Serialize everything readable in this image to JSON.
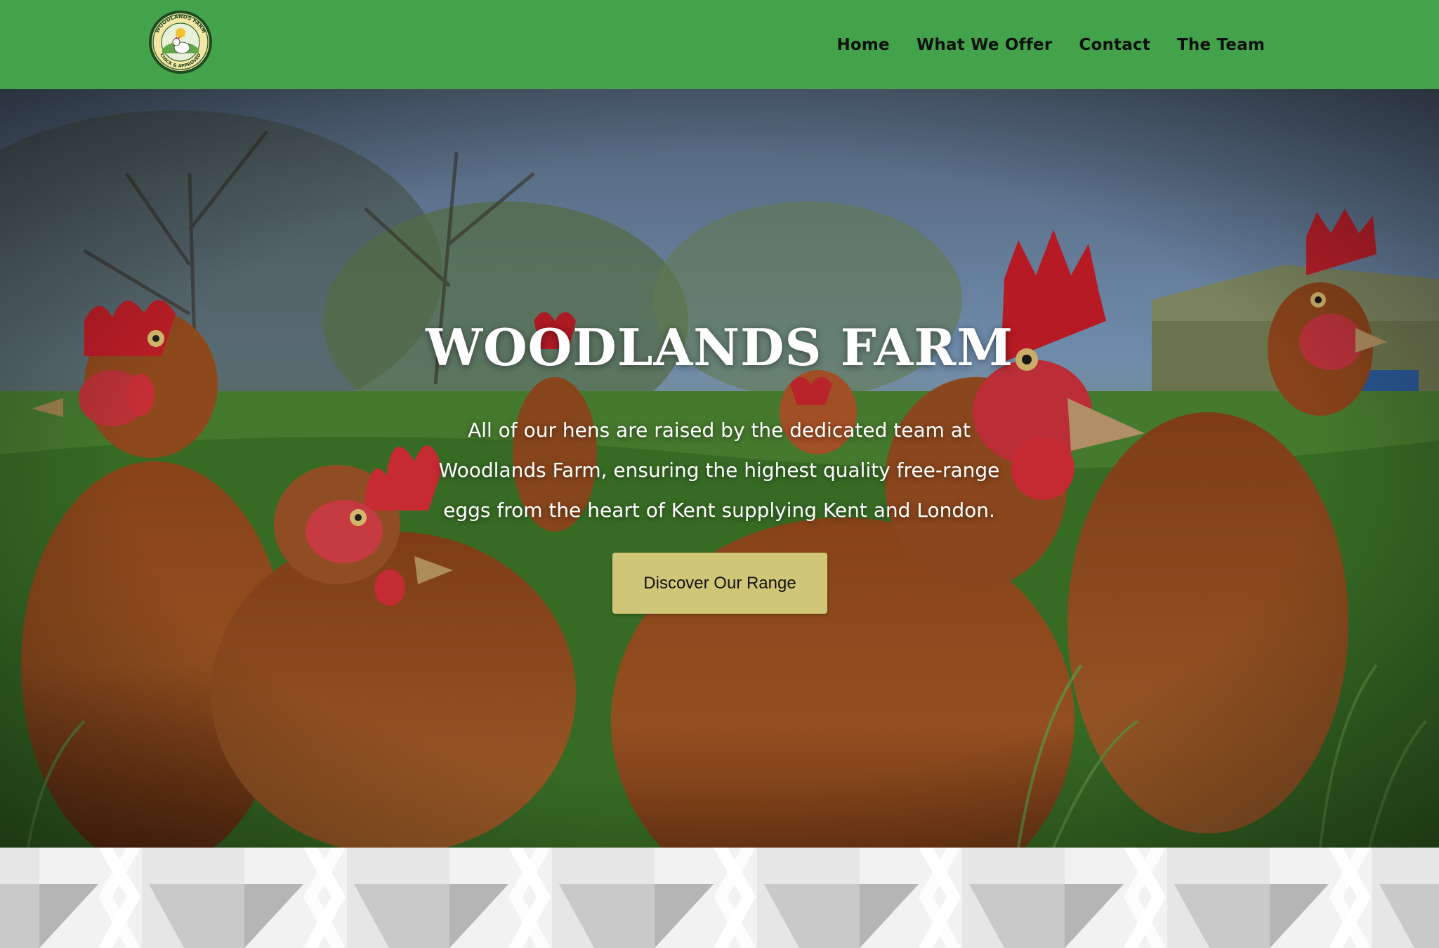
{
  "header": {
    "logo_alt": "Woodlands Farm logo",
    "logo_text_top": "WOODLANDS FARM",
    "logo_text_bottom": "CHICK & APPROVED",
    "nav": [
      {
        "label": "Home"
      },
      {
        "label": "What We Offer"
      },
      {
        "label": "Contact"
      },
      {
        "label": "The Team"
      }
    ]
  },
  "hero": {
    "title": "WOODLANDS FARM",
    "text": "All of our hens are raised by the dedicated team at Woodlands Farm, ensuring the highest quality free-range eggs from the heart of Kent supplying Kent and London.",
    "cta_label": "Discover Our Range",
    "background_image": "photo of brown free-range hens in grass"
  },
  "colors": {
    "header_bg": "#43a34a",
    "cta_bg": "#cfc777",
    "nav_text": "#111111",
    "hero_text": "#ffffff"
  }
}
